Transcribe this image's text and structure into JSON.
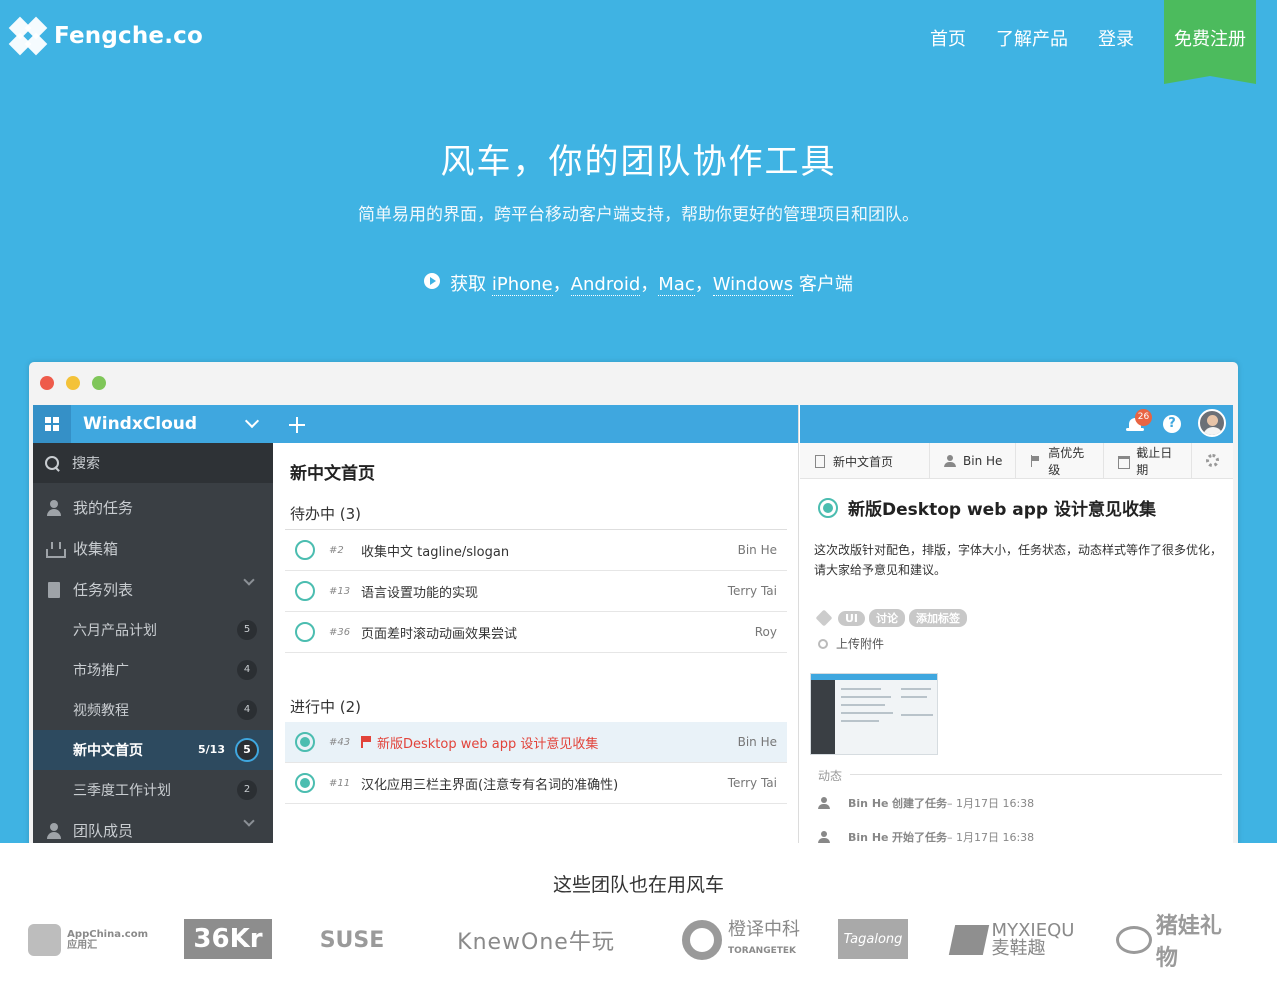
{
  "nav": {
    "logo": "Fengche.co",
    "links": [
      "首页",
      "了解产品",
      "登录"
    ],
    "signup": "免费注册"
  },
  "hero": {
    "title": "风车，你的团队协作工具",
    "subtitle": "简单易用的界面，跨平台移动客户端支持，帮助你更好的管理项目和团队。",
    "get_prefix": "获取",
    "platforms": [
      "iPhone",
      "Android",
      "Mac",
      "Windows"
    ],
    "separator": "，",
    "get_suffix": "客户端"
  },
  "app": {
    "sidebar": {
      "team": "WindxCloud",
      "search": "搜索",
      "items": [
        {
          "label": "我的任务",
          "icon": "user-icon"
        },
        {
          "label": "收集箱",
          "icon": "inbox-icon"
        },
        {
          "label": "任务列表",
          "icon": "list-icon"
        }
      ],
      "lists": [
        {
          "label": "六月产品计划",
          "count": "5"
        },
        {
          "label": "市场推广",
          "count": "4"
        },
        {
          "label": "视频教程",
          "count": "4"
        },
        {
          "label": "新中文首页",
          "count": "5",
          "ratio": "5/13",
          "active": true
        },
        {
          "label": "三季度工作计划",
          "count": "2"
        }
      ],
      "members": "团队成员"
    },
    "middle": {
      "title": "新中文首页",
      "todo_title": "待办中 (3)",
      "todo": [
        {
          "num": "#2",
          "name": "收集中文 tagline/slogan",
          "assignee": "Bin He"
        },
        {
          "num": "#13",
          "name": "语言设置功能的实现",
          "assignee": "Terry Tai"
        },
        {
          "num": "#36",
          "name": "页面差时滚动动画效果尝试",
          "assignee": "Roy"
        }
      ],
      "doing_title": "进行中 (2)",
      "doing": [
        {
          "num": "#43",
          "name": "新版Desktop web app 设计意见收集",
          "assignee": "Bin He"
        },
        {
          "num": "#11",
          "name": "汉化应用三栏主界面(注意专有名词的准确性)",
          "assignee": "Terry Tai"
        }
      ]
    },
    "right": {
      "notifications": "26",
      "help": "?",
      "meta": {
        "list": "新中文首页",
        "assignee": "Bin He",
        "priority": "高优先级",
        "due": "截止日期"
      },
      "task_title": "新版Desktop web app 设计意见收集",
      "description": "这次改版针对配色，排版，字体大小，任务状态，动态样式等作了很多优化，请大家给予意见和建议。",
      "tags": [
        "UI",
        "讨论",
        "添加标签"
      ],
      "attach": "上传附件",
      "activity_label": "动态",
      "activity": [
        {
          "who": "Bin He",
          "action": "创建了任务",
          "time": " – 1月17日 16:38"
        },
        {
          "who": "Bin He",
          "action": "开始了任务",
          "time": " – 1月17日 16:38"
        }
      ]
    }
  },
  "partners": {
    "title": "这些团队也在用风车",
    "appchina_1": "AppChina.com",
    "appchina_2": "应用汇",
    "kr36": "36Kr",
    "suse": "SUSE",
    "knewone": "KnewOne牛玩",
    "torange_1": "橙译中科",
    "torange_2": "TORANGETEK",
    "tagalong": "Tagalong",
    "myxiequ_1": "MYXIEQU",
    "myxiequ_2": "麦鞋趣",
    "zhuwa": "猪娃礼物"
  },
  "colors": {
    "hero": "#3fb3e3",
    "signup": "#4cbb5d",
    "sidebar": "#3a3f44",
    "accent": "#3fa7df",
    "task_circle": "#4bbdb0",
    "flag": "#e2433a"
  }
}
